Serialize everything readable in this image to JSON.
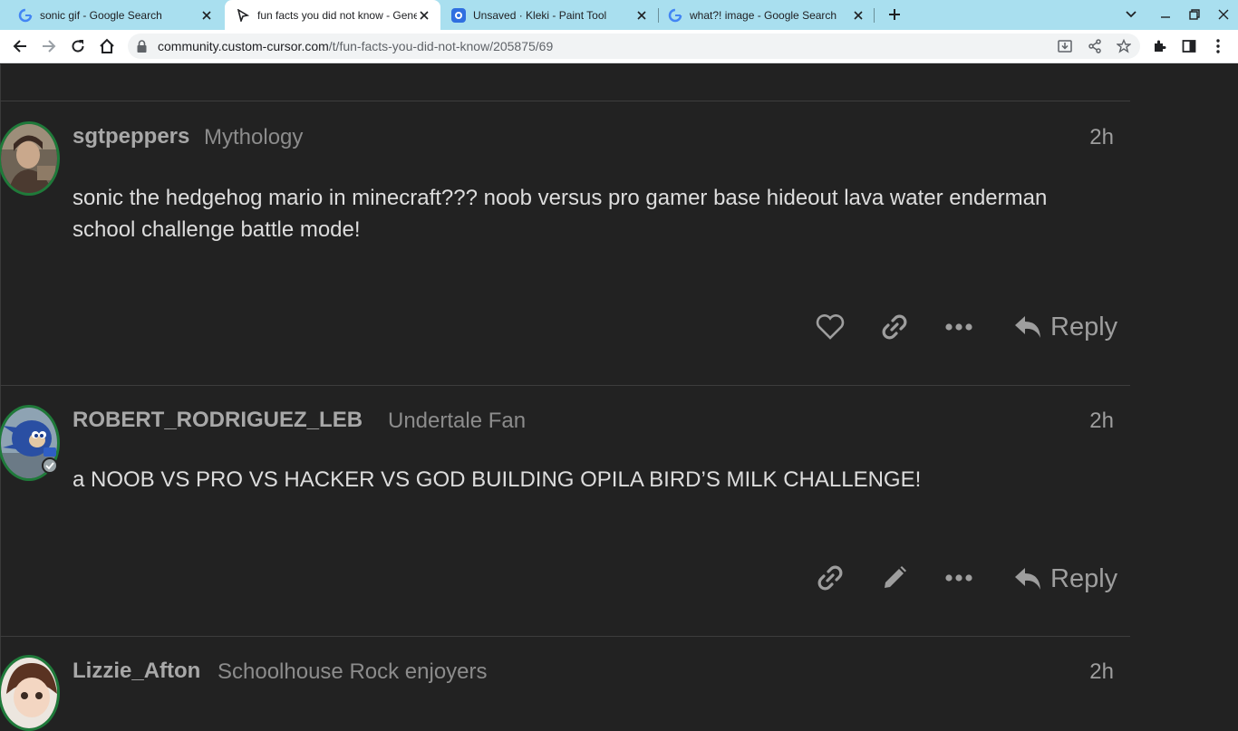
{
  "browser": {
    "tabs": [
      {
        "title": "sonic gif - Google Search",
        "icon": "google-icon"
      },
      {
        "title": "fun facts you did not know - General",
        "icon": "cursor-icon",
        "active": true
      },
      {
        "title": "Unsaved · Kleki - Paint Tool",
        "icon": "kleki-icon"
      },
      {
        "title": "what?! image - Google Search",
        "icon": "google-icon"
      }
    ],
    "url_host": "community.custom-cursor.com",
    "url_path": "/t/fun-facts-you-did-not-know/205875/69"
  },
  "posts": [
    {
      "username": "sgtpeppers",
      "user_title": "Mythology",
      "age": "2h",
      "body": "sonic the hedgehog mario in minecraft??? noob versus pro gamer base hideout lava water enderman school challenge battle mode!",
      "actions": [
        "like",
        "copy-link",
        "more"
      ],
      "reply_label": "Reply"
    },
    {
      "username": "ROBERT_RODRIGUEZ_LEB",
      "user_title": "Undertale Fan",
      "age": "2h",
      "body": "a NOOB VS PRO VS HACKER VS GOD BUILDING OPILA BIRD’S MILK CHALLENGE!",
      "actions": [
        "copy-link",
        "edit",
        "more"
      ],
      "reply_label": "Reply"
    },
    {
      "username": "Lizzie_Afton",
      "user_title": "Schoolhouse Rock enjoyers",
      "age": "2h"
    }
  ],
  "colors": {
    "page_bg": "#222222",
    "tabstrip_bg": "#a9dfef",
    "avatar_ring": "#1f7a3a",
    "text_primary": "#dddddd",
    "text_muted": "#9e9e9e"
  }
}
